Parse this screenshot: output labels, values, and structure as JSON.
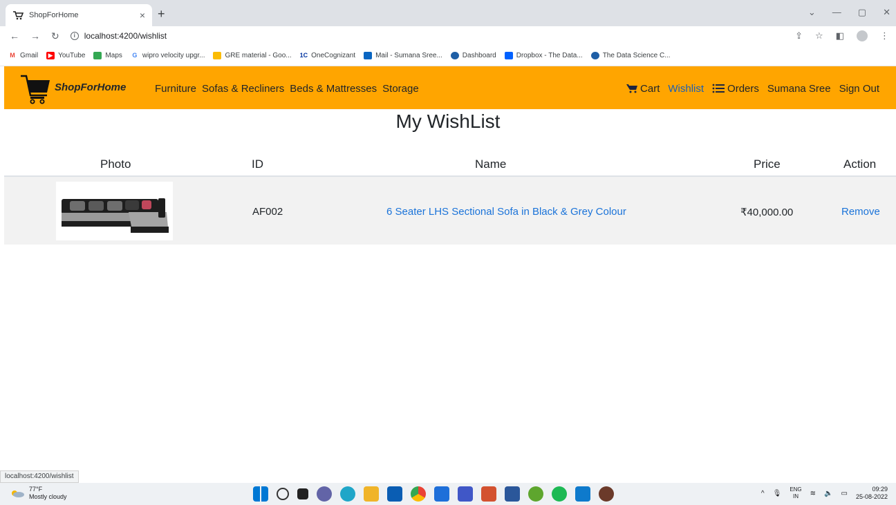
{
  "browser": {
    "tab_title": "ShopForHome",
    "tab_close": "×",
    "new_tab": "+",
    "url": "localhost:4200/wishlist",
    "bookmarks": [
      "Gmail",
      "YouTube",
      "Maps",
      "wipro velocity upgr...",
      "GRE material - Goo...",
      "OneCognizant",
      "Mail - Sumana Sree...",
      "Dashboard",
      "Dropbox - The Data...",
      "The Data Science C..."
    ],
    "status_url": "localhost:4200/wishlist"
  },
  "navbar": {
    "brand": "ShopForHome",
    "left_links": [
      "Furniture",
      "Sofas & Recliners",
      "Beds & Mattresses",
      "Storage"
    ],
    "cart": "Cart",
    "wishlist": "Wishlist",
    "orders": "Orders",
    "user": "Sumana Sree",
    "signout": "Sign Out",
    "brand_color": "#ffa500"
  },
  "page": {
    "title": "My WishList"
  },
  "table": {
    "headers": [
      "Photo",
      "ID",
      "Name",
      "Price",
      "Action"
    ],
    "rows": [
      {
        "id": "AF002",
        "name": "6 Seater LHS Sectional Sofa in Black & Grey Colour",
        "price": "₹40,000.00",
        "action": "Remove"
      }
    ]
  },
  "taskbar": {
    "temp": "77°F",
    "weather": "Mostly cloudy",
    "lang1": "ENG",
    "lang2": "IN",
    "time": "09:29",
    "date": "25-08-2022"
  }
}
